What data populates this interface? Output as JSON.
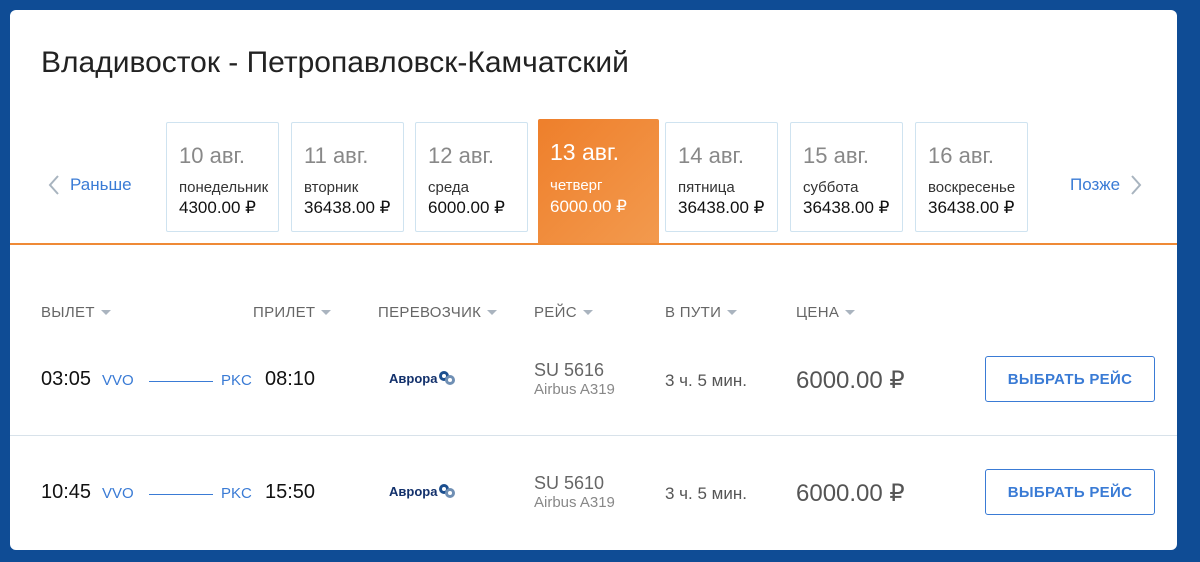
{
  "route_title": "Владивосток - Петропавловск-Камчатский",
  "nav": {
    "prev_label": "Раньше",
    "next_label": "Позже"
  },
  "dates": [
    {
      "date": "10 авг.",
      "day": "понедельник",
      "price": "4300.00 ₽",
      "active": false
    },
    {
      "date": "11 авг.",
      "day": "вторник",
      "price": "36438.00 ₽",
      "active": false
    },
    {
      "date": "12 авг.",
      "day": "среда",
      "price": "6000.00 ₽",
      "active": false
    },
    {
      "date": "13 авг.",
      "day": "четверг",
      "price": "6000.00 ₽",
      "active": true
    },
    {
      "date": "14 авг.",
      "day": "пятница",
      "price": "36438.00 ₽",
      "active": false
    },
    {
      "date": "15 авг.",
      "day": "суббота",
      "price": "36438.00 ₽",
      "active": false
    },
    {
      "date": "16 авг.",
      "day": "воскресенье",
      "price": "36438.00 ₽",
      "active": false
    }
  ],
  "columns": {
    "departure": "ВЫЛЕТ",
    "arrival": "ПРИЛЕТ",
    "carrier": "ПЕРЕВОЗЧИК",
    "flight": "РЕЙС",
    "duration": "В ПУТИ",
    "price": "ЦЕНА"
  },
  "flights": [
    {
      "dep_time": "03:05",
      "dep_code": "VVO",
      "arr_code": "PKC",
      "arr_time": "08:10",
      "carrier": "Аврора",
      "flight_no": "SU 5616",
      "aircraft": "Airbus A319",
      "duration": "3 ч. 5 мин.",
      "price": "6000.00 ₽",
      "button": "ВЫБРАТЬ РЕЙС"
    },
    {
      "dep_time": "10:45",
      "dep_code": "VVO",
      "arr_code": "PKC",
      "arr_time": "15:50",
      "carrier": "Аврора",
      "flight_no": "SU 5610",
      "aircraft": "Airbus A319",
      "duration": "3 ч. 5 мин.",
      "price": "6000.00 ₽",
      "button": "ВЫБРАТЬ РЕЙС"
    }
  ],
  "colors": {
    "accent": "#3a7bd5",
    "active_date": "#ef8a36",
    "background": "#0f4c95"
  }
}
